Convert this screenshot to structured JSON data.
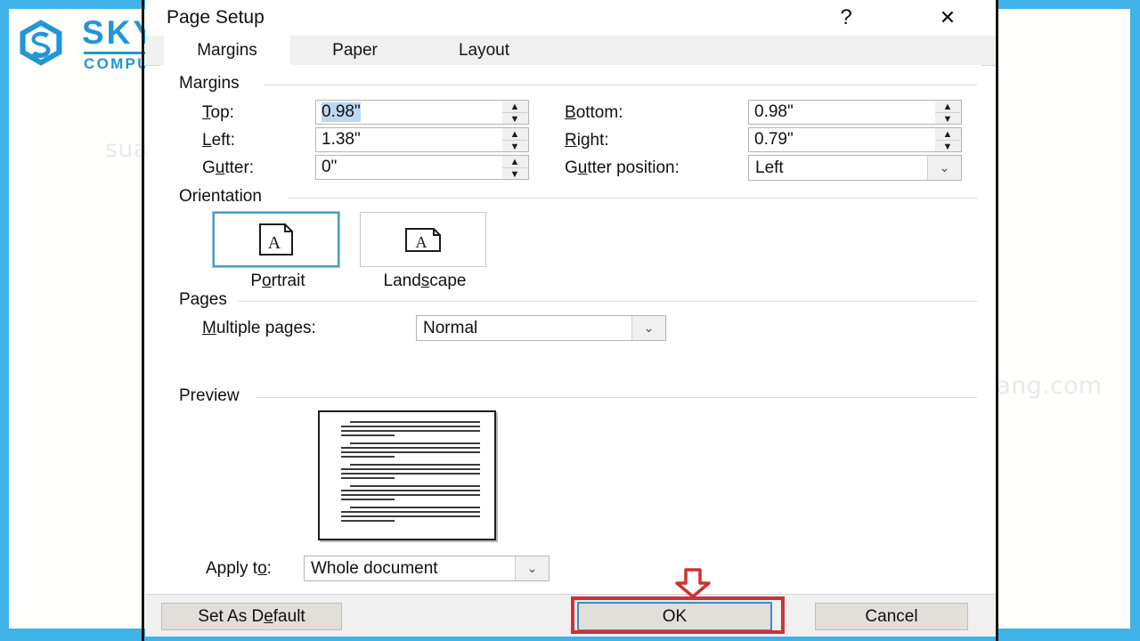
{
  "branding": {
    "logo_mark": "hexagon-s-icon",
    "name_top": "SKY",
    "name_bottom": "COMPUTER",
    "brand_color": "#2196d6"
  },
  "watermark": {
    "text": "suachuamaytinhdanang.com"
  },
  "dialog": {
    "title": "Page Setup",
    "help_icon": "?",
    "close_icon": "✕",
    "tabs": [
      {
        "label": "Margins",
        "active": true
      },
      {
        "label": "Paper",
        "active": false
      },
      {
        "label": "Layout",
        "active": false
      }
    ],
    "margins_group": {
      "title": "Margins",
      "top_label": "Top:",
      "top_value": "0.98\"",
      "bottom_label": "Bottom:",
      "bottom_value": "0.98\"",
      "left_label": "Left:",
      "left_value": "1.38\"",
      "right_label": "Right:",
      "right_value": "0.79\"",
      "gutter_label": "Gutter:",
      "gutter_value": "0\"",
      "gutter_position_label": "Gutter position:",
      "gutter_position_value": "Left",
      "spinner_up_icon": "▲",
      "spinner_down_icon": "▼",
      "dropdown_icon": "⌄"
    },
    "orientation_group": {
      "title": "Orientation",
      "portrait_label": "Portrait",
      "landscape_label": "Landscape",
      "selected": "Portrait",
      "page_icon": "page-a-icon"
    },
    "pages_group": {
      "title": "Pages",
      "multiple_pages_label": "Multiple pages:",
      "multiple_pages_value": "Normal",
      "dropdown_icon": "⌄"
    },
    "preview_group": {
      "title": "Preview",
      "page_icon": "document-preview-icon"
    },
    "apply_to": {
      "label": "Apply to:",
      "value": "Whole document",
      "dropdown_icon": "⌄"
    },
    "buttons": {
      "set_as_default": "Set As Default",
      "ok": "OK",
      "cancel": "Cancel"
    }
  },
  "annotation": {
    "highlight_color": "#c33",
    "arrow_icon": "down-arrow-annotation",
    "target": "OK"
  }
}
